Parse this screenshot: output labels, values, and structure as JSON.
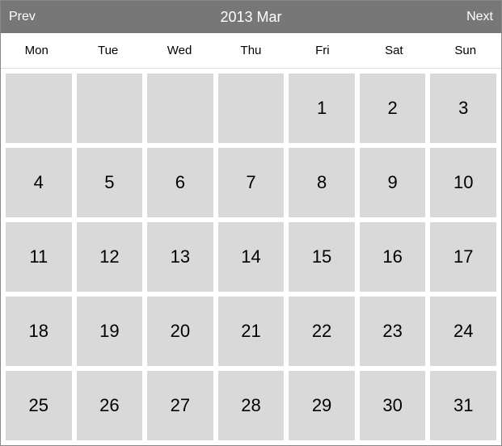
{
  "header": {
    "prev_label": "Prev",
    "next_label": "Next",
    "title": "2013 Mar"
  },
  "day_names": [
    "Mon",
    "Tue",
    "Wed",
    "Thu",
    "Fri",
    "Sat",
    "Sun"
  ],
  "cells": [
    "",
    "",
    "",
    "",
    "1",
    "2",
    "3",
    "4",
    "5",
    "6",
    "7",
    "8",
    "9",
    "10",
    "11",
    "12",
    "13",
    "14",
    "15",
    "16",
    "17",
    "18",
    "19",
    "20",
    "21",
    "22",
    "23",
    "24",
    "25",
    "26",
    "27",
    "28",
    "29",
    "30",
    "31"
  ]
}
